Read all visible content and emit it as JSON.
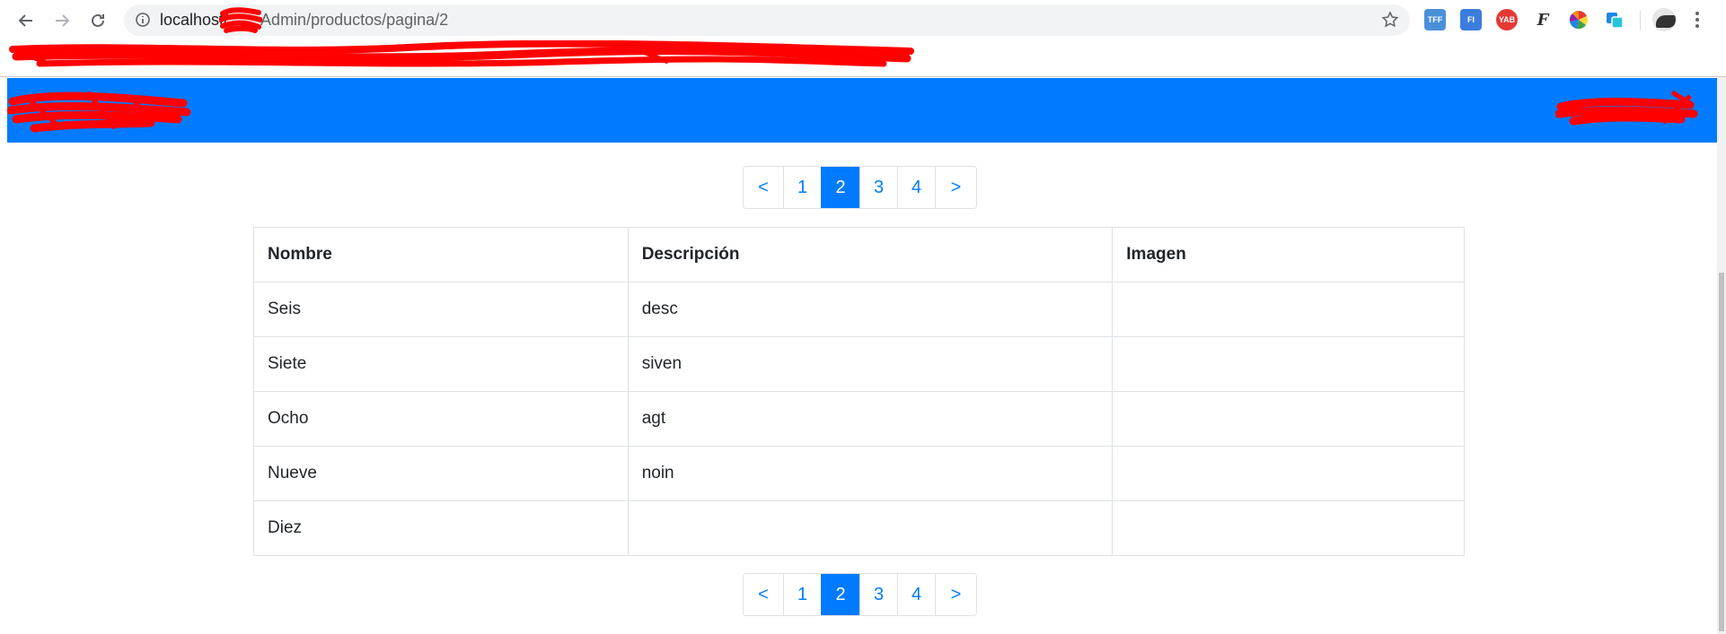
{
  "browser": {
    "url_host": "localhost/",
    "url_path": "Admin/productos/pagina/2",
    "extensions": [
      {
        "name": "tff-extension-icon",
        "label": "TFF",
        "color": "#4a90d9"
      },
      {
        "name": "fi-extension-icon",
        "label": "FI",
        "color": "#3b7ddd"
      },
      {
        "name": "yab-extension-icon",
        "label": "YAB",
        "color": "#e53935"
      },
      {
        "name": "font-extension-icon",
        "label": "F",
        "color": "#333333"
      },
      {
        "name": "color-wheel-extension-icon",
        "label": "",
        "color": "#e91e63"
      },
      {
        "name": "translate-extension-icon",
        "label": "",
        "color": "#1e88e5"
      }
    ]
  },
  "pagination": {
    "prev": "<",
    "pages": [
      "1",
      "2",
      "3",
      "4"
    ],
    "active_page": "2",
    "next": ">"
  },
  "table": {
    "headers": [
      "Nombre",
      "Descripción",
      "Imagen"
    ],
    "rows": [
      [
        "Seis",
        "desc",
        ""
      ],
      [
        "Siete",
        "siven",
        ""
      ],
      [
        "Ocho",
        "agt",
        ""
      ],
      [
        "Nueve",
        "noin",
        ""
      ],
      [
        "Diez",
        "",
        ""
      ]
    ]
  },
  "colors": {
    "primary": "#007bff",
    "redaction": "#ff0000"
  }
}
